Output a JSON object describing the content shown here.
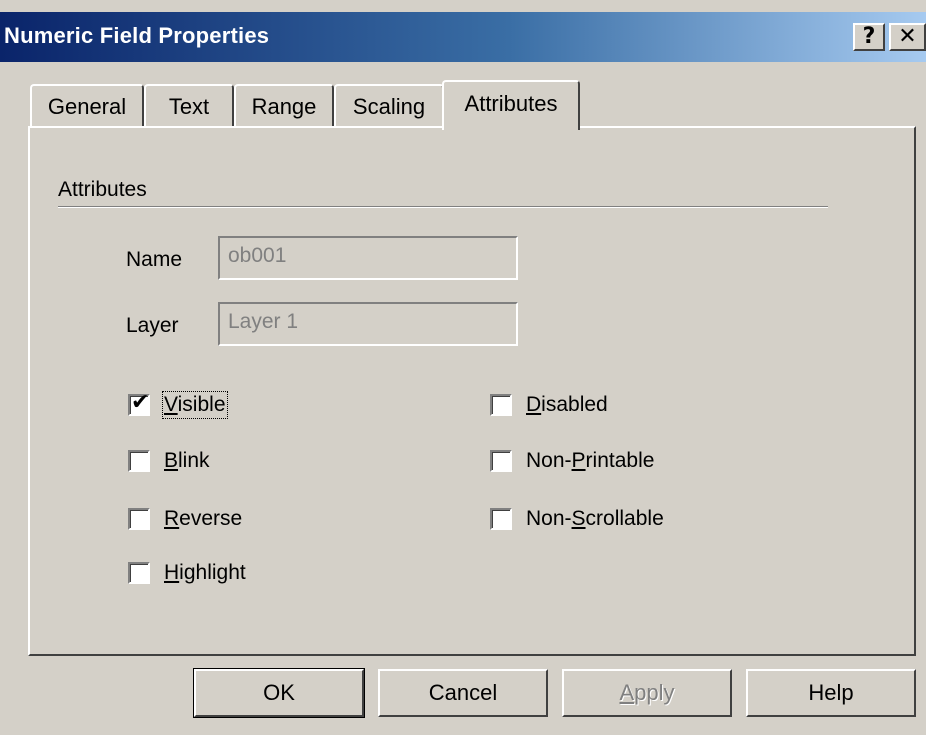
{
  "window": {
    "title": "Numeric Field Properties"
  },
  "caption_buttons": {
    "help": "?",
    "close": "✕"
  },
  "tabs": [
    {
      "label": "General"
    },
    {
      "label": "Text"
    },
    {
      "label": "Range"
    },
    {
      "label": "Scaling"
    },
    {
      "label": "Attributes"
    }
  ],
  "active_tab": "Attributes",
  "group": {
    "label": "Attributes"
  },
  "fields": {
    "name": {
      "label": "Name",
      "value": "ob001"
    },
    "layer": {
      "label": "Layer",
      "value": "Layer 1"
    }
  },
  "checkboxes": {
    "visible": {
      "label_u": "V",
      "label_rest": "isible",
      "checked": "✔"
    },
    "blink": {
      "label_u": "B",
      "label_rest": "link"
    },
    "reverse": {
      "label_u": "R",
      "label_rest": "everse"
    },
    "highlight": {
      "label_u": "H",
      "label_rest": "ighlight"
    },
    "disabled": {
      "label_u": "D",
      "label_rest": "isabled"
    },
    "non_printable": {
      "label_pre": "Non-",
      "label_u": "P",
      "label_rest": "rintable"
    },
    "non_scrollable": {
      "label_pre": "Non-",
      "label_u": "S",
      "label_rest": "crollable"
    }
  },
  "buttons": {
    "ok": "OK",
    "cancel": "Cancel",
    "apply_u": "A",
    "apply_rest": "pply",
    "help": "Help"
  }
}
